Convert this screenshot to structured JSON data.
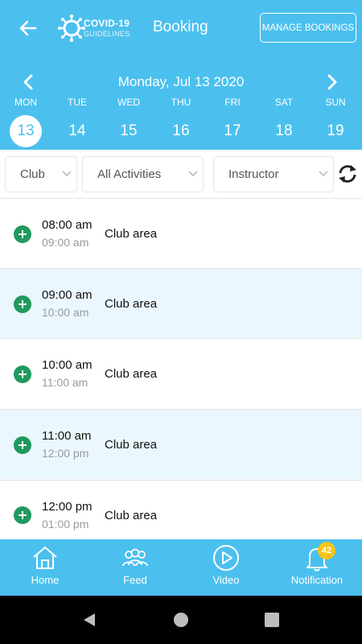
{
  "header": {
    "logo_line1": "COVID-19",
    "logo_line2": "GUIDELINES",
    "title": "Booking",
    "manage_label": "MANAGE BOOKINGS"
  },
  "calendar": {
    "date_label": "Monday, Jul 13 2020",
    "days": [
      {
        "name": "MON",
        "num": "13",
        "selected": true
      },
      {
        "name": "TUE",
        "num": "14"
      },
      {
        "name": "WED",
        "num": "15"
      },
      {
        "name": "THU",
        "num": "16"
      },
      {
        "name": "FRI",
        "num": "17"
      },
      {
        "name": "SAT",
        "num": "18"
      },
      {
        "name": "SUN",
        "num": "19"
      }
    ]
  },
  "filters": {
    "club": "Club",
    "activities": "All Activities",
    "instructor": "Instructor"
  },
  "sessions": [
    {
      "start": "08:00 am",
      "end": "09:00 am",
      "area": "Club area"
    },
    {
      "start": "09:00 am",
      "end": "10:00 am",
      "area": "Club area"
    },
    {
      "start": "10:00 am",
      "end": "11:00 am",
      "area": "Club area"
    },
    {
      "start": "11:00 am",
      "end": "12:00 pm",
      "area": "Club area"
    },
    {
      "start": "12:00 pm",
      "end": "01:00 pm",
      "area": "Club area"
    }
  ],
  "tabs": [
    {
      "label": "Home",
      "icon": "home-icon"
    },
    {
      "label": "Feed",
      "icon": "people-icon"
    },
    {
      "label": "Video",
      "icon": "play-icon"
    },
    {
      "label": "Notification",
      "icon": "bell-icon"
    }
  ],
  "notification_badge": "42",
  "colors": {
    "accent": "#4bc0ee",
    "row_alt": "#eaf7fe",
    "add_green": "#1f9a5c",
    "badge": "#f5c518"
  }
}
